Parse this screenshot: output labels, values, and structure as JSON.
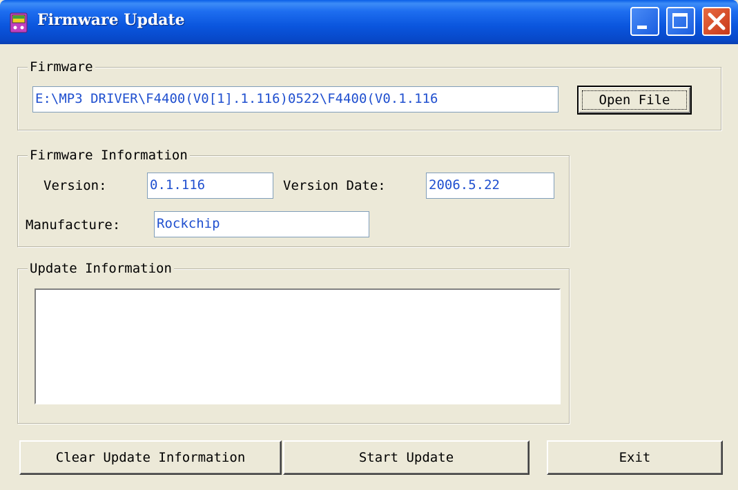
{
  "window": {
    "title": "Firmware Update",
    "icon": "mp3-player-icon"
  },
  "title_buttons": {
    "minimize": "minimize-icon",
    "maximize": "maximize-icon",
    "close": "close-icon"
  },
  "firmware_group": {
    "label": "Firmware",
    "path_value": "E:\\MP3 DRIVER\\F4400(V0[1].1.116)0522\\F4400(V0.1.116",
    "open_file_label": "Open File"
  },
  "info_group": {
    "label": "Firmware Information",
    "version_label": "Version:",
    "version_value": "0.1.116",
    "date_label": "Version Date:",
    "date_value": "2006.5.22",
    "manufacture_label": "Manufacture:",
    "manufacture_value": "Rockchip"
  },
  "update_group": {
    "label": "Update Information",
    "log_text": ""
  },
  "actions": {
    "clear_label": "Clear Update Information",
    "start_label": "Start Update",
    "exit_label": "Exit"
  },
  "colors": {
    "titlebar": "#0a55dd",
    "window_bg": "#ece9d8",
    "field_text": "#1f4fcf",
    "close_button": "#c8391a"
  }
}
